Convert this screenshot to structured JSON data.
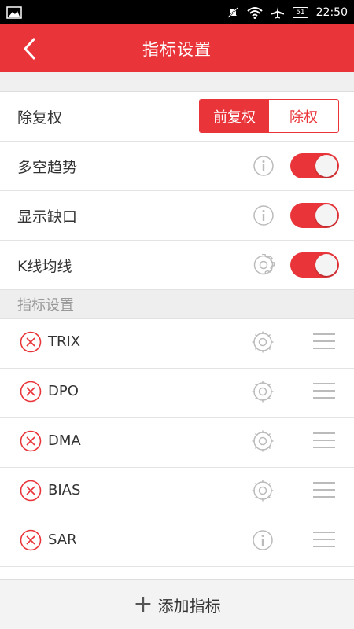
{
  "status_bar": {
    "time": "22:50",
    "battery": "51"
  },
  "header": {
    "title": "指标设置"
  },
  "settings": {
    "adjust": {
      "label": "除复权",
      "options": [
        "前复权",
        "除权"
      ],
      "selected": "前复权"
    },
    "trend": {
      "label": "多空趋势",
      "enabled": true
    },
    "gap": {
      "label": "显示缺口",
      "enabled": true
    },
    "kline_ma": {
      "label": "K线均线",
      "enabled": true
    }
  },
  "section_title": "指标设置",
  "indicators": [
    {
      "name": "TRIX",
      "icon": "gear-icon"
    },
    {
      "name": "DPO",
      "icon": "gear-icon"
    },
    {
      "name": "DMA",
      "icon": "gear-icon"
    },
    {
      "name": "BIAS",
      "icon": "gear-icon"
    },
    {
      "name": "SAR",
      "icon": "info-icon"
    }
  ],
  "footer": {
    "add_label": "添加指标"
  },
  "colors": {
    "accent": "#e9353a"
  }
}
